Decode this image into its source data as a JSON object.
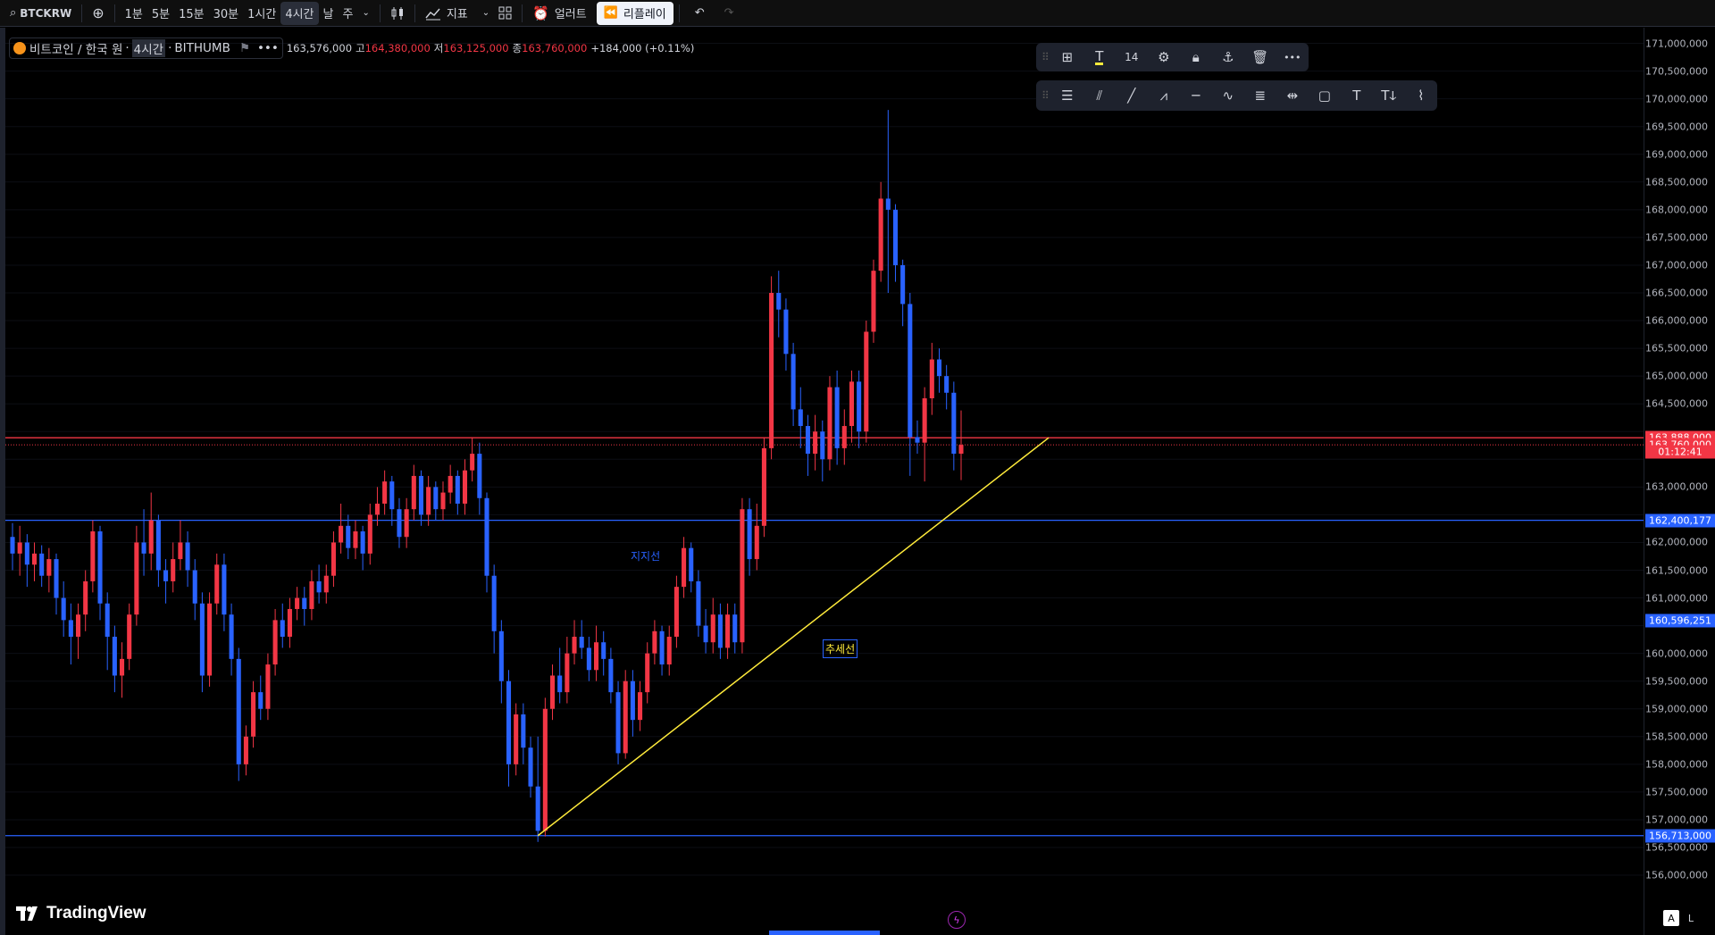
{
  "toolbar": {
    "symbol": "BTCKRW",
    "intervals": [
      "1분",
      "5분",
      "15분",
      "30분",
      "1시간",
      "4시간",
      "날",
      "주"
    ],
    "active_interval": "4시간",
    "indicators_label": "지표",
    "alert_label": "얼러트",
    "replay_label": "리플레이"
  },
  "legend": {
    "title": "비트코인 / 한국 원",
    "interval": "4시간",
    "exchange": "BITHUMB",
    "open_label": "",
    "open": "163,576,000",
    "high_label": "고",
    "high": "164,380,000",
    "low_label": "저",
    "low": "163,125,000",
    "close_label": "종",
    "close": "163,760,000",
    "change": "+184,000 (+0.11%)"
  },
  "float_toolbar": {
    "font_size": "14"
  },
  "price_axis": {
    "ticks": [
      "171,000,000",
      "170,500,000",
      "170,000,000",
      "169,500,000",
      "169,000,000",
      "168,500,000",
      "168,000,000",
      "167,500,000",
      "167,000,000",
      "166,500,000",
      "166,000,000",
      "165,500,000",
      "165,000,000",
      "164,500,000",
      "163,000,000",
      "162,000,000",
      "161,500,000",
      "161,000,000",
      "160,000,000",
      "159,500,000",
      "159,000,000",
      "158,500,000",
      "158,000,000",
      "157,500,000",
      "157,000,000",
      "156,500,000",
      "156,000,000"
    ],
    "tick_values": [
      171000000,
      170500000,
      170000000,
      169500000,
      169000000,
      168500000,
      168000000,
      167500000,
      167000000,
      166500000,
      166000000,
      165500000,
      165000000,
      164500000,
      163000000,
      162000000,
      161500000,
      161000000,
      160000000,
      159500000,
      159000000,
      158500000,
      158000000,
      157500000,
      157000000,
      156500000,
      156000000
    ],
    "labels": [
      {
        "text": "163,888,000",
        "value": 163888000,
        "color": "#f23645"
      },
      {
        "text": "163,760,000",
        "value": 163760000,
        "color": "#f23645"
      },
      {
        "text": "01:12:41",
        "value": 163630000,
        "color": "#f23645"
      },
      {
        "text": "162,400,177",
        "value": 162400177,
        "color": "#2962ff"
      },
      {
        "text": "160,596,251",
        "value": 160596251,
        "color": "#2962ff"
      },
      {
        "text": "156,713,000",
        "value": 156713000,
        "color": "#2962ff"
      }
    ]
  },
  "annotations": {
    "support_label": "지지선",
    "trend_label": "추세선"
  },
  "chart_data": {
    "type": "candlestick",
    "symbol": "BTCKRW",
    "interval": "4시간",
    "ylim": [
      155800000,
      171200000
    ],
    "candles": [
      [
        162100000,
        161800000,
        162350000,
        161500000
      ],
      [
        161800000,
        162000000,
        162300000,
        161400000
      ],
      [
        162000000,
        161600000,
        162150000,
        161200000
      ],
      [
        161600000,
        161800000,
        162000000,
        161300000
      ],
      [
        161800000,
        161400000,
        161950000,
        161200000
      ],
      [
        161400000,
        161700000,
        161900000,
        161100000
      ],
      [
        161700000,
        161000000,
        161800000,
        160700000
      ],
      [
        161000000,
        160600000,
        161300000,
        160300000
      ],
      [
        160600000,
        160300000,
        160900000,
        159800000
      ],
      [
        160300000,
        160700000,
        160900000,
        159900000
      ],
      [
        160700000,
        161300000,
        161500000,
        160400000
      ],
      [
        161300000,
        162200000,
        162400000,
        161100000
      ],
      [
        162200000,
        160900000,
        162300000,
        160600000
      ],
      [
        160900000,
        160300000,
        161100000,
        159700000
      ],
      [
        160300000,
        159600000,
        160500000,
        159300000
      ],
      [
        159600000,
        159900000,
        160200000,
        159200000
      ],
      [
        159900000,
        160700000,
        160900000,
        159700000
      ],
      [
        160700000,
        162000000,
        162300000,
        160500000
      ],
      [
        162000000,
        161800000,
        162600000,
        161400000
      ],
      [
        161800000,
        162400000,
        162900000,
        161500000
      ],
      [
        162400000,
        161500000,
        162500000,
        161200000
      ],
      [
        161500000,
        161300000,
        161700000,
        160900000
      ],
      [
        161300000,
        161700000,
        162000000,
        161100000
      ],
      [
        161700000,
        162000000,
        162400000,
        161500000
      ],
      [
        162000000,
        161500000,
        162200000,
        161200000
      ],
      [
        161500000,
        160900000,
        161700000,
        160600000
      ],
      [
        160900000,
        159600000,
        161100000,
        159300000
      ],
      [
        159600000,
        160900000,
        161100000,
        159400000
      ],
      [
        160900000,
        161600000,
        161800000,
        160700000
      ],
      [
        161600000,
        160700000,
        161800000,
        160400000
      ],
      [
        160700000,
        159900000,
        160900000,
        159600000
      ],
      [
        159900000,
        158000000,
        160100000,
        157700000
      ],
      [
        158000000,
        158500000,
        158700000,
        157800000
      ],
      [
        158500000,
        159300000,
        159500000,
        158300000
      ],
      [
        159300000,
        159000000,
        159600000,
        158800000
      ],
      [
        159000000,
        159800000,
        160000000,
        158800000
      ],
      [
        159800000,
        160600000,
        160800000,
        159600000
      ],
      [
        160600000,
        160300000,
        160900000,
        160100000
      ],
      [
        160300000,
        160800000,
        161000000,
        160100000
      ],
      [
        160800000,
        161000000,
        161200000,
        160600000
      ],
      [
        161000000,
        160800000,
        161200000,
        160500000
      ],
      [
        160800000,
        161300000,
        161500000,
        160600000
      ],
      [
        161300000,
        161100000,
        161600000,
        160900000
      ],
      [
        161100000,
        161400000,
        161600000,
        160900000
      ],
      [
        161400000,
        162000000,
        162200000,
        161200000
      ],
      [
        162000000,
        162300000,
        162700000,
        161800000
      ],
      [
        162300000,
        161900000,
        162500000,
        161700000
      ],
      [
        161900000,
        162200000,
        162400000,
        161700000
      ],
      [
        162200000,
        161800000,
        162300000,
        161500000
      ],
      [
        161800000,
        162500000,
        162700000,
        161600000
      ],
      [
        162500000,
        162700000,
        163000000,
        162300000
      ],
      [
        162700000,
        163100000,
        163300000,
        162500000
      ],
      [
        163100000,
        162600000,
        163200000,
        162300000
      ],
      [
        162600000,
        162100000,
        162800000,
        161900000
      ],
      [
        162100000,
        162600000,
        162800000,
        161900000
      ],
      [
        162600000,
        163200000,
        163400000,
        162400000
      ],
      [
        163200000,
        162500000,
        163300000,
        162300000
      ],
      [
        162500000,
        163000000,
        163200000,
        162300000
      ],
      [
        163000000,
        162600000,
        163100000,
        162400000
      ],
      [
        162600000,
        162900000,
        163100000,
        162400000
      ],
      [
        162900000,
        163200000,
        163400000,
        162700000
      ],
      [
        163200000,
        162700000,
        163300000,
        162500000
      ],
      [
        162700000,
        163300000,
        163500000,
        162500000
      ],
      [
        163300000,
        163600000,
        163900000,
        163100000
      ],
      [
        163600000,
        162800000,
        163800000,
        162500000
      ],
      [
        162800000,
        161400000,
        162900000,
        161100000
      ],
      [
        161400000,
        160400000,
        161600000,
        160000000
      ],
      [
        160400000,
        159500000,
        160600000,
        159100000
      ],
      [
        159500000,
        158000000,
        159700000,
        157600000
      ],
      [
        158000000,
        158900000,
        159100000,
        157800000
      ],
      [
        158900000,
        158300000,
        159100000,
        158000000
      ],
      [
        158300000,
        157600000,
        158500000,
        157400000
      ],
      [
        157600000,
        156800000,
        158500000,
        156600000
      ],
      [
        156800000,
        159000000,
        159200000,
        156700000
      ],
      [
        159000000,
        159600000,
        159800000,
        158800000
      ],
      [
        159600000,
        159300000,
        160100000,
        159100000
      ],
      [
        159300000,
        160000000,
        160300000,
        159100000
      ],
      [
        160000000,
        160300000,
        160600000,
        159800000
      ],
      [
        160300000,
        160100000,
        160600000,
        159900000
      ],
      [
        160100000,
        159700000,
        160300000,
        159500000
      ],
      [
        159700000,
        160200000,
        160500000,
        159500000
      ],
      [
        160200000,
        159900000,
        160400000,
        159600000
      ],
      [
        159900000,
        159300000,
        160100000,
        159100000
      ],
      [
        159300000,
        158200000,
        159500000,
        158000000
      ],
      [
        158200000,
        159500000,
        159700000,
        158100000
      ],
      [
        159500000,
        158800000,
        159700000,
        158500000
      ],
      [
        158800000,
        159300000,
        159500000,
        158600000
      ],
      [
        159300000,
        160000000,
        160200000,
        159100000
      ],
      [
        160000000,
        160400000,
        160600000,
        159800000
      ],
      [
        160400000,
        159800000,
        160500000,
        159600000
      ],
      [
        159800000,
        160300000,
        160500000,
        159600000
      ],
      [
        160300000,
        161200000,
        161400000,
        160100000
      ],
      [
        161200000,
        161900000,
        162100000,
        161000000
      ],
      [
        161900000,
        161300000,
        162000000,
        161100000
      ],
      [
        161300000,
        160500000,
        161500000,
        160300000
      ],
      [
        160500000,
        160200000,
        160800000,
        160000000
      ],
      [
        160200000,
        160700000,
        161000000,
        160000000
      ],
      [
        160700000,
        160100000,
        160900000,
        159900000
      ],
      [
        160100000,
        160700000,
        160900000,
        159900000
      ],
      [
        160700000,
        160200000,
        160900000,
        160000000
      ],
      [
        160200000,
        162600000,
        162800000,
        160000000
      ],
      [
        162600000,
        161700000,
        162800000,
        161400000
      ],
      [
        161700000,
        162300000,
        162700000,
        161500000
      ],
      [
        162300000,
        163700000,
        163900000,
        162100000
      ],
      [
        163700000,
        166500000,
        166800000,
        163500000
      ],
      [
        166500000,
        166200000,
        166900000,
        165700000
      ],
      [
        166200000,
        165400000,
        166400000,
        165100000
      ],
      [
        165400000,
        164400000,
        165600000,
        164100000
      ],
      [
        164400000,
        164100000,
        164800000,
        163700000
      ],
      [
        164100000,
        163600000,
        164300000,
        163200000
      ],
      [
        163600000,
        164000000,
        164300000,
        163300000
      ],
      [
        164000000,
        163500000,
        164200000,
        163100000
      ],
      [
        163500000,
        164800000,
        165000000,
        163300000
      ],
      [
        164800000,
        163700000,
        165100000,
        163400000
      ],
      [
        163700000,
        164100000,
        164400000,
        163400000
      ],
      [
        164100000,
        164900000,
        165100000,
        163800000
      ],
      [
        164900000,
        164000000,
        165100000,
        163700000
      ],
      [
        164000000,
        165800000,
        166000000,
        163800000
      ],
      [
        165800000,
        166900000,
        167100000,
        165600000
      ],
      [
        166900000,
        168200000,
        168500000,
        166700000
      ],
      [
        168200000,
        168000000,
        169800000,
        166500000
      ],
      [
        168000000,
        167000000,
        168100000,
        166700000
      ],
      [
        167000000,
        166300000,
        167100000,
        165900000
      ],
      [
        166300000,
        163900000,
        166500000,
        163200000
      ],
      [
        163900000,
        163800000,
        164200000,
        163600000
      ],
      [
        163800000,
        164600000,
        164800000,
        163100000
      ],
      [
        164600000,
        165300000,
        165600000,
        164300000
      ],
      [
        165300000,
        165000000,
        165500000,
        164700000
      ],
      [
        165000000,
        164700000,
        165200000,
        164400000
      ],
      [
        164700000,
        163600000,
        164900000,
        163300000
      ],
      [
        163600000,
        163760000,
        164380000,
        163125000
      ]
    ],
    "horizontal_lines": [
      {
        "value": 163888000,
        "color": "#f23645"
      },
      {
        "value": 163760000,
        "color": "#f23645",
        "style": "dotted"
      },
      {
        "value": 162400177,
        "color": "#2962ff"
      },
      {
        "value": 156713000,
        "color": "#2962ff"
      }
    ],
    "trend_line": {
      "from_candle": 72,
      "from_value": 156713000,
      "to_value": 163888000,
      "extend_bars": 12,
      "color": "#ffeb3b"
    }
  }
}
